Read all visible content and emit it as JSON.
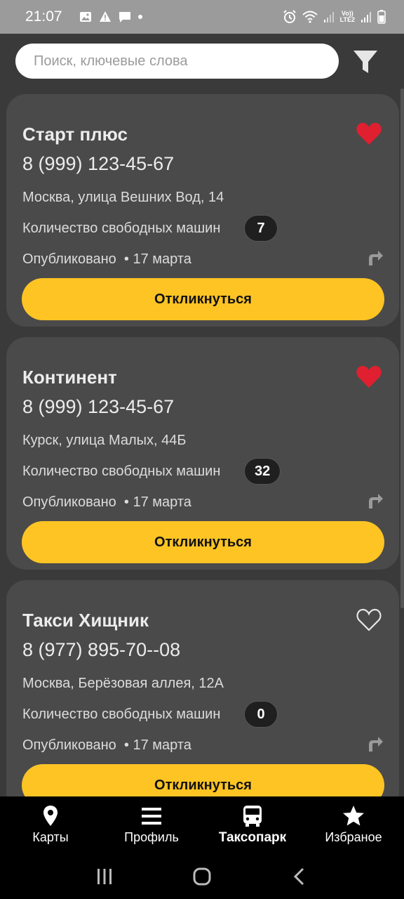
{
  "status_bar": {
    "time": "21:07",
    "icons_left": [
      "image-icon",
      "warning-icon",
      "chat-icon",
      "dot-icon"
    ],
    "icons_right": [
      "alarm-icon",
      "wifi-icon",
      "signal-icon",
      "volte-lte2-icon",
      "signal-icon",
      "battery-icon"
    ],
    "network_label_top": "Vo))",
    "network_label_bottom": "LTE2"
  },
  "search": {
    "placeholder": "Поиск, ключевые слова",
    "filter_icon": "filter-icon"
  },
  "cards": [
    {
      "title": "Старт плюс",
      "phone": "8 (999) 123-45-67",
      "address": "Москва, улица Вешних Вод, 14",
      "count_label": "Количество свободных машин",
      "count": "7",
      "published": "Опубликовано  • 17 марта",
      "favorite": true,
      "button": "Откликнуться"
    },
    {
      "title": "Континент",
      "phone": "8 (999) 123-45-67",
      "address": "Курск, улица Малых, 44Б",
      "count_label": "Количество свободных машин",
      "count": "32",
      "published": "Опубликовано  • 17 марта",
      "favorite": true,
      "button": "Откликнуться"
    },
    {
      "title": "Такси Хищник",
      "phone": "8 (977) 895-70--08",
      "address": "Москва, Берёзовая аллея, 12А",
      "count_label": "Количество свободных машин",
      "count": "0",
      "published": "Опубликовано  • 17 марта",
      "favorite": false,
      "button": "Откликнуться"
    }
  ],
  "bottom_nav": {
    "items": [
      {
        "label": "Карты",
        "icon": "map-pin-icon",
        "active": false
      },
      {
        "label": "Профиль",
        "icon": "menu-icon",
        "active": false
      },
      {
        "label": "Таксопарк",
        "icon": "bus-icon",
        "active": true
      },
      {
        "label": "Избраное",
        "icon": "star-icon",
        "active": false
      }
    ]
  },
  "colors": {
    "background": "#3a3a3a",
    "card": "#4a4a4a",
    "accent_yellow": "#fdc424",
    "favorite_red": "#e02030",
    "status_bar": "#9b9b9b",
    "nav_background": "#000000"
  }
}
